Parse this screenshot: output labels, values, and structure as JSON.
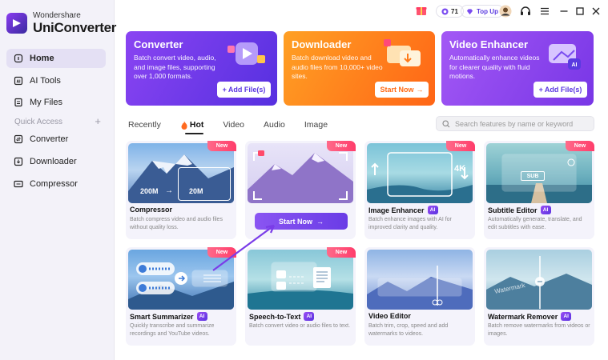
{
  "app": {
    "brand_top": "Wondershare",
    "brand_name": "UniConverter"
  },
  "sidebar": {
    "items": [
      {
        "label": "Home",
        "icon": "home-icon",
        "active": true
      },
      {
        "label": "AI Tools",
        "icon": "ai-tools-icon"
      },
      {
        "label": "My Files",
        "icon": "files-icon"
      }
    ],
    "quick_access": {
      "label": "Quick Access",
      "add": "+"
    },
    "quick_items": [
      {
        "label": "Converter",
        "icon": "converter-icon"
      },
      {
        "label": "Downloader",
        "icon": "downloader-icon"
      },
      {
        "label": "Compressor",
        "icon": "compressor-icon"
      }
    ]
  },
  "topbar": {
    "coins": "71",
    "topup": "Top Up"
  },
  "banners": [
    {
      "title": "Converter",
      "desc": "Batch convert video, audio, and image files, supporting over 1,000 formats.",
      "button": "Add File(s)",
      "color_from": "#7b3df0",
      "color_to": "#5b2de0"
    },
    {
      "title": "Downloader",
      "desc": "Batch download video and audio files from 10,000+ video sites.",
      "button": "Start Now",
      "color_from": "#ff9a1f",
      "color_to": "#ff6a18"
    },
    {
      "title": "Video Enhancer",
      "desc": "Automatically enhance videos for clearer quality with fluid motions.",
      "button": "Add File(s)",
      "color_from": "#9c52f4",
      "color_to": "#7a3ae8"
    }
  ],
  "tabs": [
    "Recently",
    "Hot",
    "Video",
    "Audio",
    "Image"
  ],
  "active_tab": "Hot",
  "search": {
    "placeholder": "Search features by name or keyword"
  },
  "cards": [
    {
      "title": "Compressor",
      "desc": "Batch compress video and audio files without quality loss.",
      "badge": "New",
      "ai": false,
      "from_size": "200M",
      "to_size": "20M"
    },
    {
      "title": "",
      "desc": "",
      "badge": "New",
      "ai": false
    },
    {
      "title": "Image Enhancer",
      "desc": "Batch enhance images with AI for improved clarity and quality.",
      "badge": "New",
      "ai": true,
      "res": "4K"
    },
    {
      "title": "Subtitle Editor",
      "desc": "Automatically generate, translate, and edit subtitles with ease.",
      "badge": "New",
      "ai": true,
      "sub": "SUB"
    },
    {
      "title": "Smart Summarizer",
      "desc": "Quickly transcribe and summarize recordings and YouTube videos.",
      "badge": "New",
      "ai": true
    },
    {
      "title": "Speech-to-Text",
      "desc": "Batch convert video or audio files to text.",
      "badge": "New",
      "ai": true
    },
    {
      "title": "Video Editor",
      "desc": "Batch trim, crop, speed and add watermarks to videos.",
      "badge": "",
      "ai": false
    },
    {
      "title": "Watermark Remover",
      "desc": "Batch remove watermarks from videos or images.",
      "badge": "",
      "ai": true,
      "wm": "Watermark"
    }
  ],
  "start_now": "Start Now",
  "ai_label": "AI"
}
